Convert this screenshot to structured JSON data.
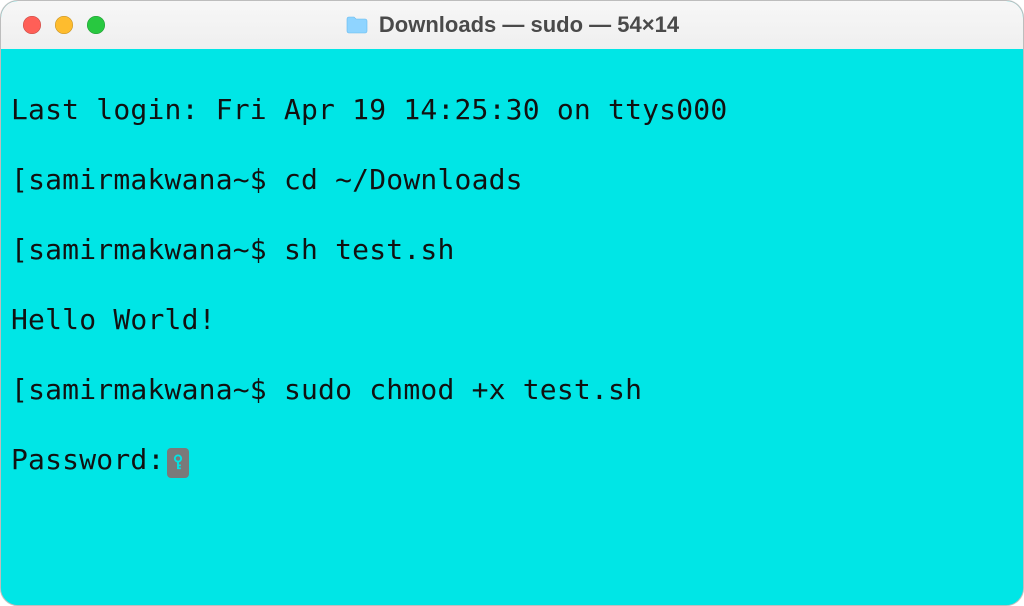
{
  "window": {
    "title": "Downloads — sudo — 54×14"
  },
  "terminal": {
    "last_login": "Last login: Fri Apr 19 14:25:30 on ttys000",
    "prompt": "samirmakwana~$ ",
    "marker": "[",
    "cmd1": "cd ~/Downloads",
    "cmd2": "sh test.sh",
    "output1": "Hello World!",
    "cmd3": "sudo chmod +x test.sh",
    "password_label": "Password:"
  }
}
